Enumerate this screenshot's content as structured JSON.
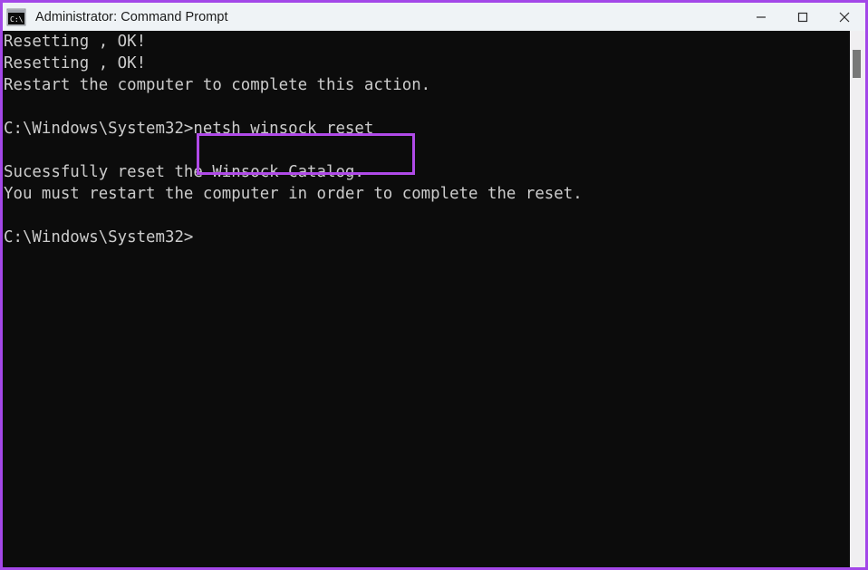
{
  "window": {
    "title": "Administrator: Command Prompt",
    "icon": "command-prompt-icon",
    "border_color": "#a347e8",
    "titlebar_bg": "#eff3f6",
    "controls": {
      "minimize_label": "Minimize",
      "maximize_label": "Maximize",
      "close_label": "Close"
    }
  },
  "console": {
    "background_color": "#0c0c0c",
    "text_color": "#cccccc",
    "lines": [
      "Resetting , OK!",
      "Resetting , OK!",
      "Restart the computer to complete this action.",
      "",
      "C:\\Windows\\System32>netsh winsock reset",
      "",
      "Sucessfully reset the Winsock Catalog.",
      "You must restart the computer in order to complete the reset.",
      "",
      "C:\\Windows\\System32>"
    ],
    "prompt": "C:\\Windows\\System32>",
    "command": "netsh winsock reset"
  },
  "annotation": {
    "target_text": "netsh winsock reset",
    "color": "#b04ae8"
  },
  "scrollbar": {
    "track_color": "#f0eff1",
    "thumb_color": "#787878"
  }
}
